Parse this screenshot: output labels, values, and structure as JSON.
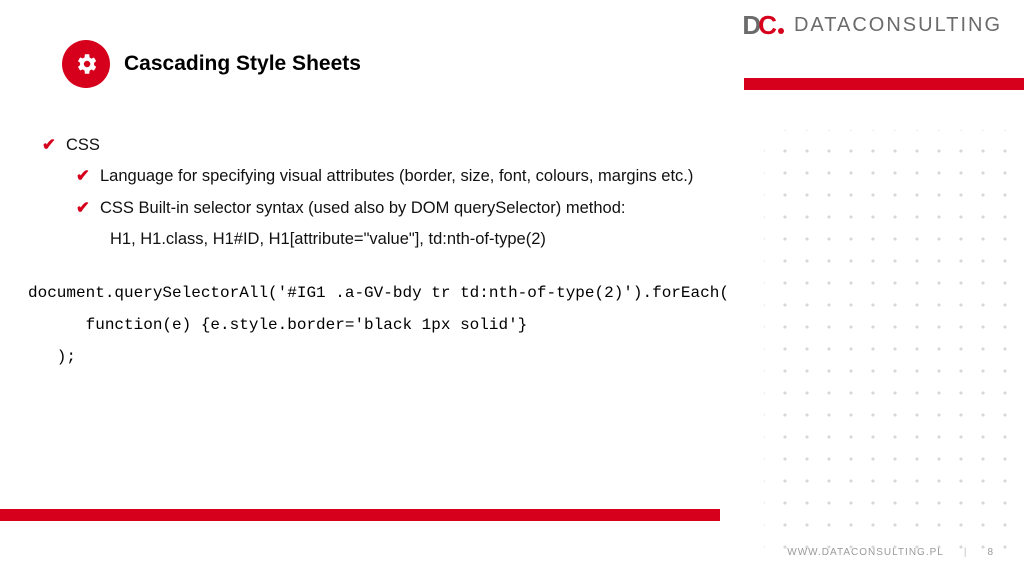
{
  "logo": {
    "mark": "DC",
    "text": "DATACONSULTING"
  },
  "title": "Cascading Style Sheets",
  "bullets": {
    "l1": "CSS",
    "l2a": "Language for specifying visual attributes (border, size, font, colours, margins etc.)",
    "l2b": "CSS Built-in selector syntax (used also by DOM querySelector) method:",
    "l3": "H1, H1.class, H1#ID, H1[attribute=\"value\"], td:nth-of-type(2)"
  },
  "code": {
    "line1": "document.querySelectorAll('#IG1 .a-GV-bdy tr td:nth-of-type(2)').forEach(",
    "line2": "      function(e) {e.style.border='black 1px solid'}",
    "line3": "   );"
  },
  "footer": {
    "url": "WWW.DATACONSULTING.PL",
    "page": "8"
  }
}
